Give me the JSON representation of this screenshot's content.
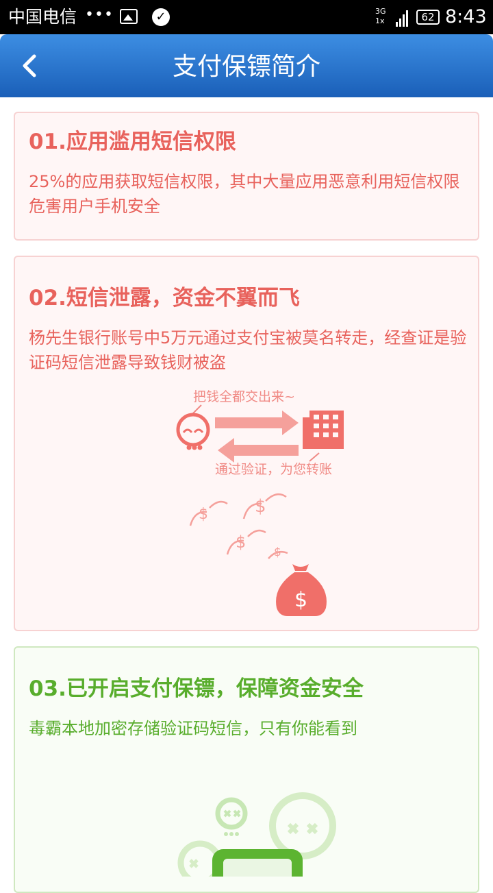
{
  "status_bar": {
    "carrier": "中国电信",
    "dots": "•••",
    "network": "3G",
    "network2": "1x",
    "battery": "62",
    "time": "8:43"
  },
  "header": {
    "title": "支付保镖简介",
    "back_icon": "chevron-left-icon"
  },
  "cards": [
    {
      "title": "01.应用滥用短信权限",
      "text": "25%的应用获取短信权限，其中大量应用恶意利用短信权限危害用户手机安全"
    },
    {
      "title": "02.短信泄露，资金不翼而飞",
      "text": "杨先生银行账号中5万元通过支付宝被莫名转走，经查证是验证码短信泄露导致钱财被盗",
      "illustration": {
        "top_caption": "把钱全都交出来~",
        "bottom_caption": "通过验证，为您转账"
      }
    },
    {
      "title": "03.已开启支付保镖，保障资金安全",
      "text": "毒霸本地加密存储验证码短信，只有你能看到"
    }
  ],
  "colors": {
    "header": "#2672d0",
    "danger": "#e8625c",
    "safe": "#58ad2c"
  }
}
